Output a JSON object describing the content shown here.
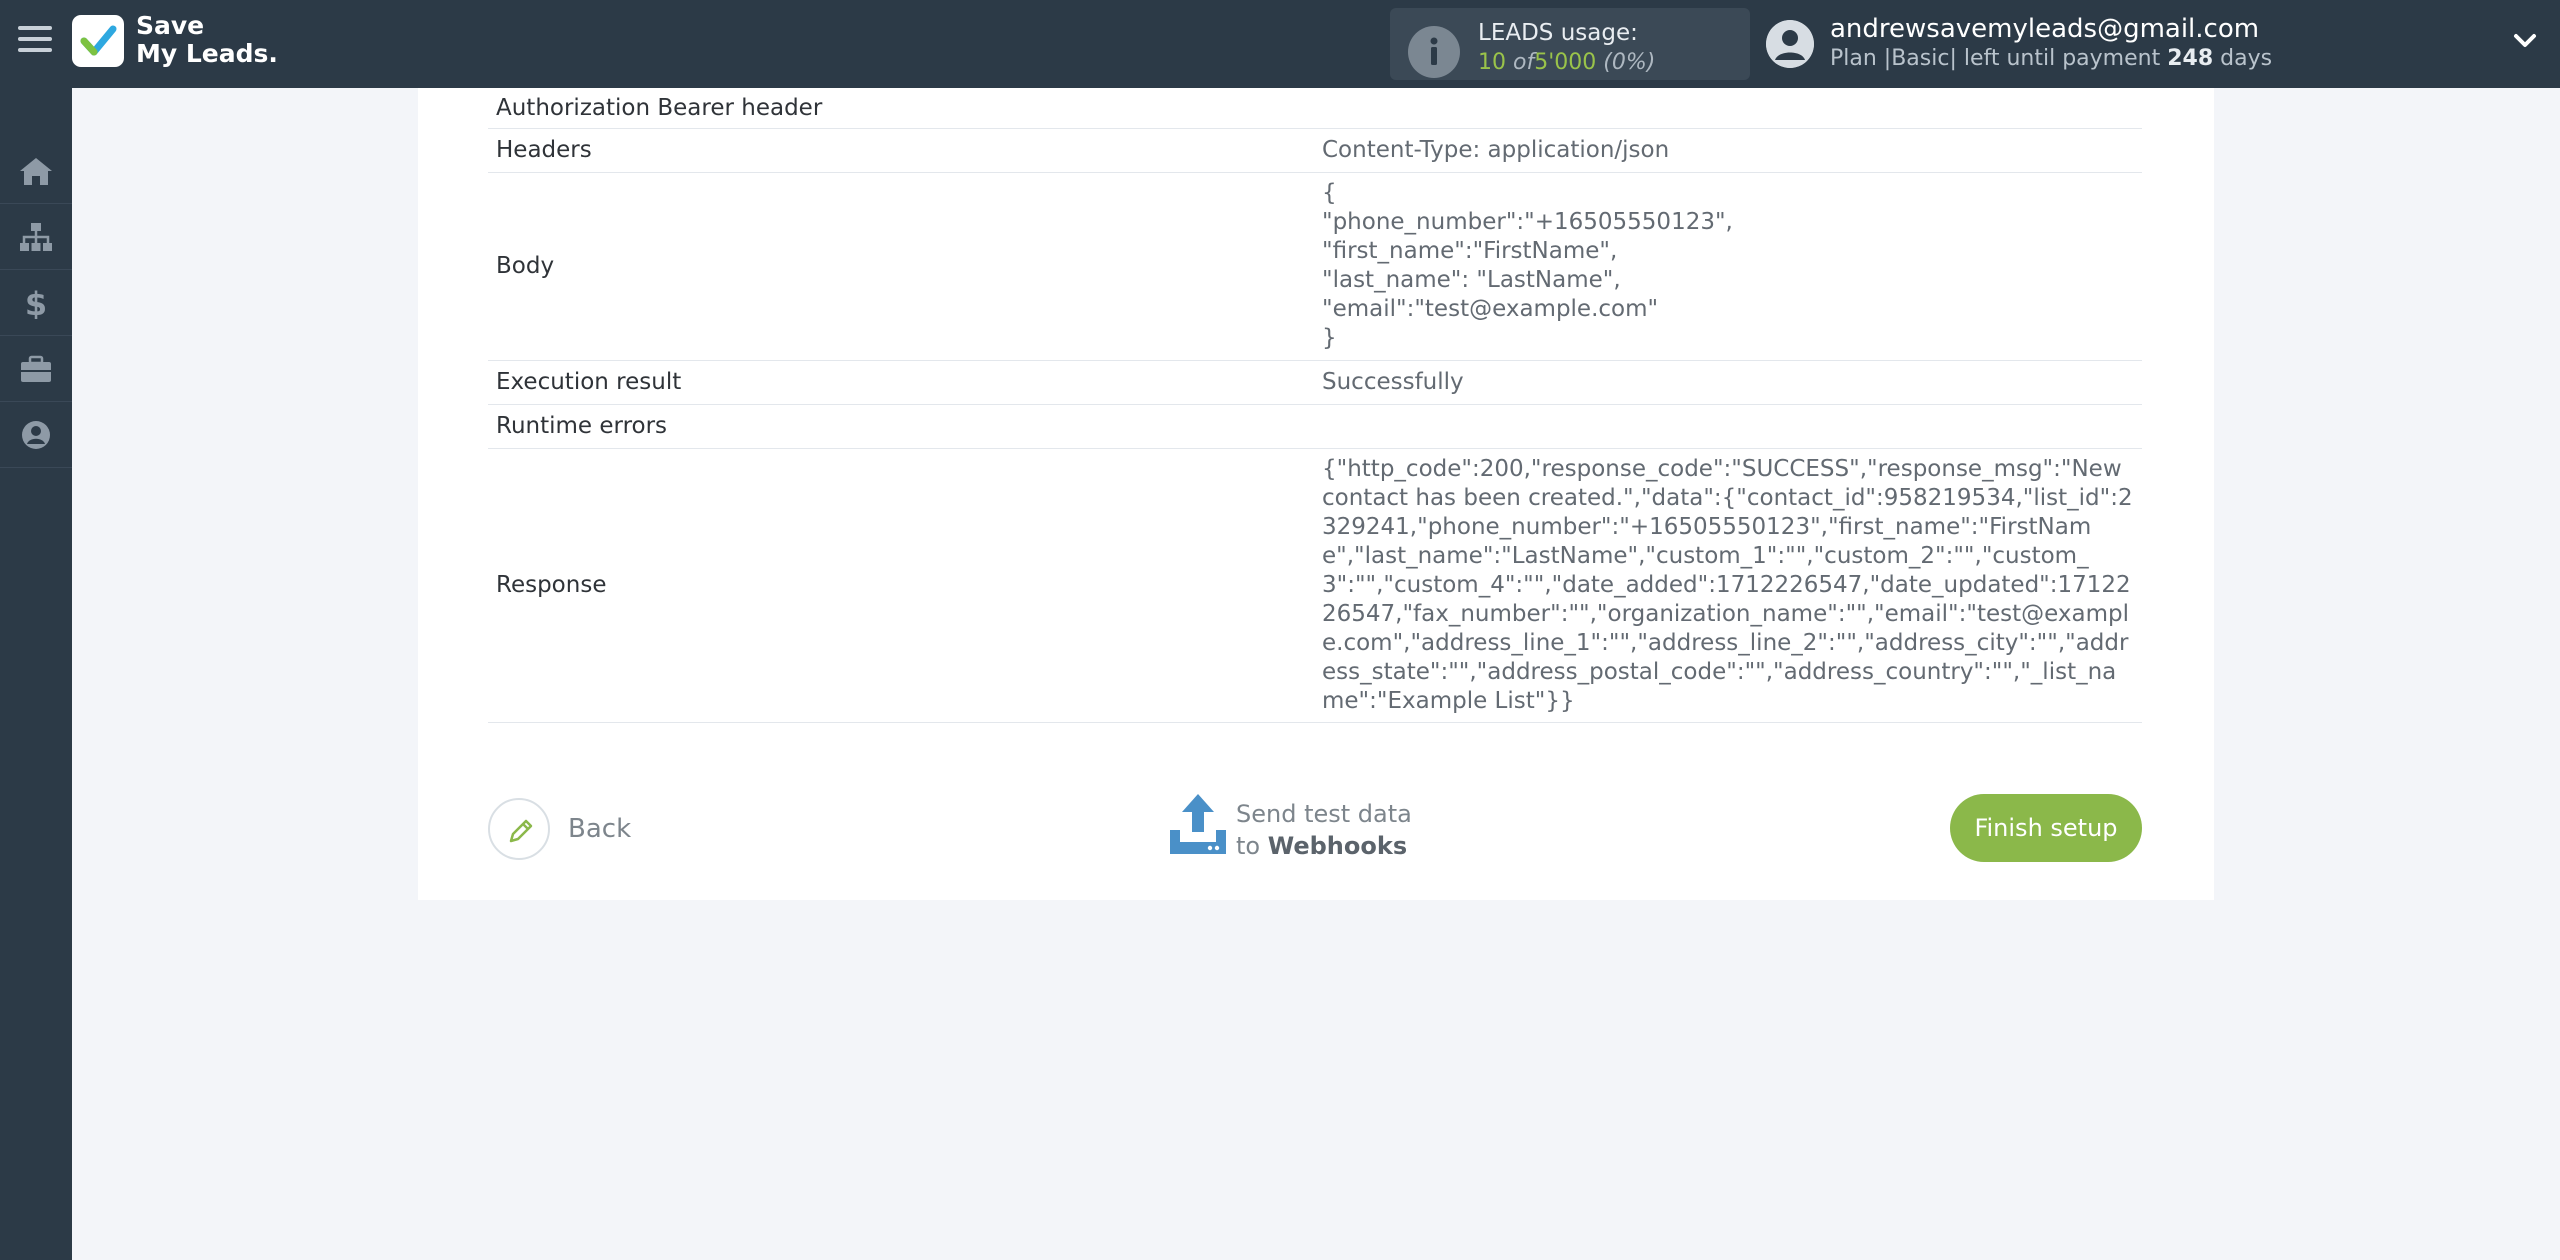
{
  "header": {
    "logo_line1": "Save",
    "logo_line2": "My Leads.",
    "usage_title": "LEADS usage:",
    "usage_used": "10",
    "usage_of": "of",
    "usage_limit": "5'000",
    "usage_pct": "(0%)",
    "email": "andrewsavemyleads@gmail.com",
    "plan_prefix": "Plan |Basic| left until payment",
    "plan_days": "248",
    "plan_suffix": "days"
  },
  "sidebar": {
    "items": [
      {
        "icon": "home-icon"
      },
      {
        "icon": "sitemap-icon"
      },
      {
        "icon": "dollar-icon"
      },
      {
        "icon": "briefcase-icon"
      },
      {
        "icon": "user-circle-icon"
      }
    ]
  },
  "table": {
    "rows": [
      {
        "key": "Authorization Bearer header",
        "value": ""
      },
      {
        "key": "Headers",
        "value": "Content-Type: application/json"
      },
      {
        "key": "Body",
        "value": "{\n\"phone_number\":\"+16505550123\",\n\"first_name\":\"FirstName\",\n\"last_name\": \"LastName\",\n\"email\":\"test@example.com\"\n}"
      },
      {
        "key": "Execution result",
        "value": "Successfully"
      },
      {
        "key": "Runtime errors",
        "value": ""
      },
      {
        "key": "Response",
        "value": "{\"http_code\":200,\"response_code\":\"SUCCESS\",\"response_msg\":\"New contact has been created.\",\"data\":{\"contact_id\":958219534,\"list_id\":2329241,\"phone_number\":\"+16505550123\",\"first_name\":\"FirstName\",\"last_name\":\"LastName\",\"custom_1\":\"\",\"custom_2\":\"\",\"custom_3\":\"\",\"custom_4\":\"\",\"date_added\":1712226547,\"date_updated\":1712226547,\"fax_number\":\"\",\"organization_name\":\"\",\"email\":\"test@example.com\",\"address_line_1\":\"\",\"address_line_2\":\"\",\"address_city\":\"\",\"address_state\":\"\",\"address_postal_code\":\"\",\"address_country\":\"\",\"_list_name\":\"Example List\"}}"
      }
    ]
  },
  "footer": {
    "back_label": "Back",
    "send_line1": "Send test data",
    "send_to": "to",
    "send_target": "Webhooks",
    "finish_label": "Finish setup"
  },
  "colors": {
    "topbar": "#2c3a47",
    "accent_green": "#8bb84a",
    "usage_green": "#9ac34a",
    "upload_blue": "#4a90c8"
  }
}
